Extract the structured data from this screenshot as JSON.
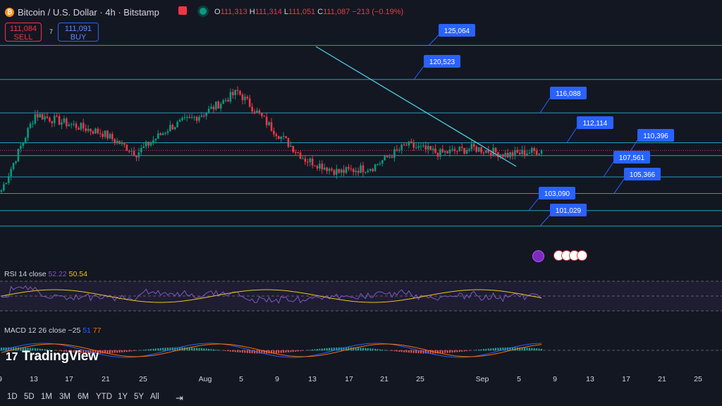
{
  "header": {
    "logo_glyph": "₿",
    "title": "Bitcoin / U.S. Dollar · 4h · Bitstamp",
    "ohlc": [
      {
        "k": "O",
        "v": "111,313"
      },
      {
        "k": "H",
        "v": "111,314"
      },
      {
        "k": "L",
        "v": "111,051"
      },
      {
        "k": "C",
        "v": "111,087"
      },
      {
        "k": "",
        "v": "−213 (−0.19%)"
      }
    ]
  },
  "trade": {
    "sell_price": "111,084",
    "sell_label": "SELL",
    "buy_price": "111,091",
    "buy_label": "BUY",
    "spread": "7"
  },
  "colors": {
    "up": "#089981",
    "down": "#f23645",
    "level": "#1fa2ba",
    "trend": "#4dd0e1",
    "label_bg": "#2962ff",
    "rsi": "#7e57c2",
    "rsi_ma": "#f0c419",
    "macd": "#2962ff",
    "signal": "#ff6d00"
  },
  "chart_data": [
    {
      "type": "line",
      "series": [
        {
          "x_index": [
            0,
            14,
            28,
            42,
            56,
            70,
            84,
            98,
            112,
            126,
            140,
            154,
            168,
            182,
            196,
            210,
            224
          ],
          "close": [
            105.8,
            115.9,
            114.6,
            113.4,
            110.7,
            114.2,
            116.0,
            118.9,
            114.1,
            109.9,
            108.2,
            108.9,
            111.8,
            110.7,
            111.4,
            110.5,
            111.1
          ]
        }
      ],
      "horizontal_levels": [
        "125,064",
        "120,523",
        "116,088",
        "112,114",
        "110,396",
        "107,561",
        "105,366",
        "103,090",
        "101,029"
      ],
      "x_tick_labels": [
        "9",
        "13",
        "17",
        "21",
        "25",
        "Aug",
        "5",
        "9",
        "13",
        "17",
        "21",
        "25",
        "Sep",
        "5",
        "9",
        "13",
        "17",
        "21",
        "25"
      ],
      "annotations": [
        "trendline from Aug 13 high to early Sep"
      ]
    },
    {
      "type": "line",
      "title": "RSI 14 close",
      "values_label": [
        "52.22",
        "50.54"
      ]
    },
    {
      "type": "bar",
      "title": "MACD 12 26 close",
      "values_label": [
        "−25",
        "51",
        "77"
      ]
    }
  ],
  "branding": {
    "logo_text": "TradingView",
    "logo_mark": "17"
  },
  "range_buttons": [
    "1D",
    "5D",
    "1M",
    "3M",
    "6M",
    "YTD",
    "1Y",
    "5Y",
    "All"
  ]
}
